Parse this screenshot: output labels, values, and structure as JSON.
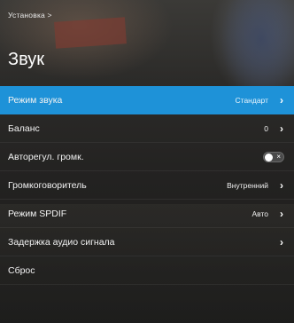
{
  "breadcrumb": "Установка >",
  "page_title": "Звук",
  "colors": {
    "accent": "#1e92d8"
  },
  "menu": {
    "items": [
      {
        "label": "Режим звука",
        "value": "Стандарт",
        "control": "chevron-right-icon",
        "selected": true
      },
      {
        "label": "Баланс",
        "value": "0",
        "control": "chevron-right-icon"
      },
      {
        "label": "Авторегул. громк.",
        "value": "",
        "control": "toggle",
        "toggle_on": false
      },
      {
        "label": "Громкоговоритель",
        "value": "Внутренний",
        "control": "chevron-right-icon"
      },
      {
        "label": "Режим SPDIF",
        "value": "Авто",
        "control": "chevron-right-icon"
      },
      {
        "label": "Задержка аудио сигнала",
        "value": "",
        "control": "chevron-right-icon"
      },
      {
        "label": "Сброс",
        "value": "",
        "control": "none"
      }
    ]
  }
}
